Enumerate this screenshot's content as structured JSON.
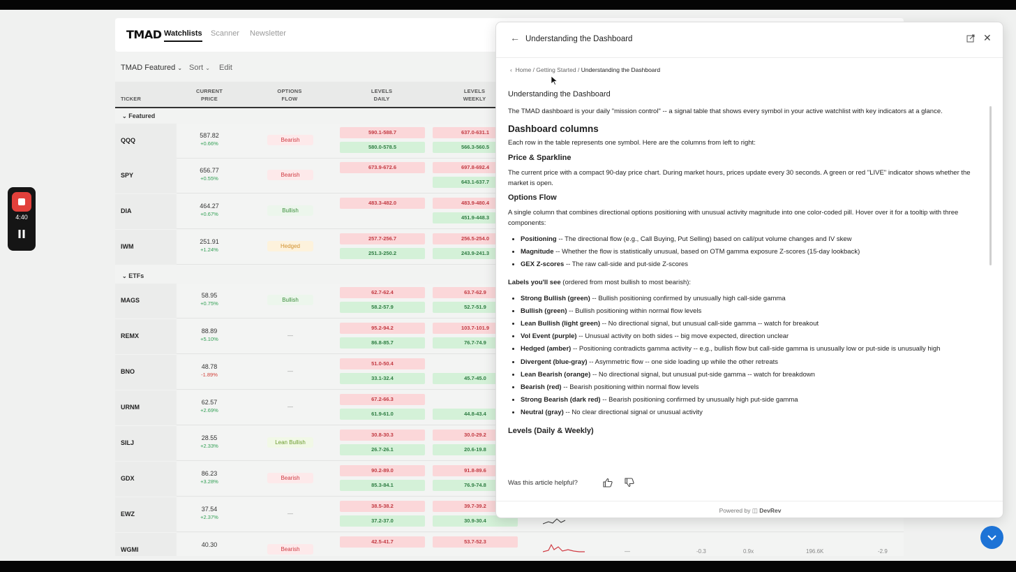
{
  "app": {
    "logo": "TMAD",
    "nav": [
      "Watchlists",
      "Scanner",
      "Newsletter"
    ],
    "toolbar": {
      "watchlist": "TMAD Featured",
      "sort": "Sort",
      "edit": "Edit"
    }
  },
  "table": {
    "headers": {
      "ticker": "TICKER",
      "price_1": "CURRENT",
      "price_2": "PRICE",
      "flow_1": "OPTIONS",
      "flow_2": "FLOW",
      "ld_1": "LEVELS",
      "ld_2": "DAILY",
      "lw_1": "LEVELS",
      "lw_2": "WEEKLY"
    },
    "groups": [
      "Featured",
      "ETFs"
    ],
    "rows": [
      {
        "ticker": "QQQ",
        "price": "587.82",
        "chg": "+0.66%",
        "neg": false,
        "flow": "Bearish",
        "cls": "bear",
        "d1": "590.1-588.7",
        "d2": "580.0-578.5",
        "w1": "637.0-631.1",
        "w2": "566.3-560.5"
      },
      {
        "ticker": "SPY",
        "price": "656.77",
        "chg": "+0.55%",
        "neg": false,
        "flow": "Bearish",
        "cls": "bear",
        "d1": "673.9-672.6",
        "d2": "",
        "w1": "697.8-692.4",
        "w2": "643.1-637.7"
      },
      {
        "ticker": "DIA",
        "price": "464.27",
        "chg": "+0.67%",
        "neg": false,
        "flow": "Bullish",
        "cls": "bull",
        "d1": "483.3-482.0",
        "d2": "",
        "w1": "483.9-480.4",
        "w2": "451.9-448.3"
      },
      {
        "ticker": "IWM",
        "price": "251.91",
        "chg": "+1.24%",
        "neg": false,
        "flow": "Hedged",
        "cls": "hedg",
        "d1": "257.7-256.7",
        "d2": "251.3-250.2",
        "w1": "256.5-254.0",
        "w2": "243.9-241.3"
      },
      {
        "ticker": "MAGS",
        "price": "58.95",
        "chg": "+0.75%",
        "neg": false,
        "flow": "Bullish",
        "cls": "bull",
        "d1": "62.7-62.4",
        "d2": "58.2-57.9",
        "w1": "63.7-62.9",
        "w2": "52.7-51.9"
      },
      {
        "ticker": "REMX",
        "price": "88.89",
        "chg": "+5.10%",
        "neg": false,
        "flow": "—",
        "cls": "none",
        "d1": "95.2-94.2",
        "d2": "86.8-85.7",
        "w1": "103.7-101.9",
        "w2": "76.7-74.9"
      },
      {
        "ticker": "BNO",
        "price": "48.78",
        "chg": "-1.89%",
        "neg": true,
        "flow": "—",
        "cls": "none",
        "d1": "51.0-50.4",
        "d2": "33.1-32.4",
        "w1": "",
        "w2": "45.7-45.0"
      },
      {
        "ticker": "URNM",
        "price": "62.57",
        "chg": "+2.69%",
        "neg": false,
        "flow": "—",
        "cls": "none",
        "d1": "67.2-66.3",
        "d2": "61.9-61.0",
        "w1": "",
        "w2": "44.8-43.4"
      },
      {
        "ticker": "SILJ",
        "price": "28.55",
        "chg": "+2.33%",
        "neg": false,
        "flow": "Lean Bullish",
        "cls": "lean",
        "d1": "30.8-30.3",
        "d2": "26.7-26.1",
        "w1": "30.0-29.2",
        "w2": "20.6-19.8"
      },
      {
        "ticker": "GDX",
        "price": "86.23",
        "chg": "+3.28%",
        "neg": false,
        "flow": "Bearish",
        "cls": "bear",
        "d1": "90.2-89.0",
        "d2": "85.3-84.1",
        "w1": "91.8-89.6",
        "w2": "76.9-74.8"
      },
      {
        "ticker": "EWZ",
        "price": "37.54",
        "chg": "+2.37%",
        "neg": false,
        "flow": "—",
        "cls": "none",
        "d1": "38.5-38.2",
        "d2": "37.2-37.0",
        "w1": "39.7-39.2",
        "w2": "30.9-30.4"
      },
      {
        "ticker": "WGMI",
        "price": "40.30",
        "chg": "",
        "neg": false,
        "flow": "Bearish",
        "cls": "bear",
        "d1": "42.5-41.7",
        "d2": "",
        "w1": "53.7-52.3",
        "w2": ""
      }
    ],
    "peek": [
      "—",
      "-0.3",
      "0.9x",
      "196.6K",
      "-2.9"
    ]
  },
  "panel": {
    "title": "Understanding the Dashboard",
    "breadcrumb": {
      "home": "Home",
      "sep1": "/",
      "getting_started": "Getting Started",
      "sep2": "/",
      "current": "Understanding the Dashboard"
    },
    "h_main": "Understanding the Dashboard",
    "intro": "The TMAD dashboard is your daily \"mission control\" -- a signal table that shows every symbol in your active watchlist with key indicators at a glance.",
    "h_columns": "Dashboard columns",
    "columns_intro": "Each row in the table represents one symbol. Here are the columns from left to right:",
    "h_price": "Price & Sparkline",
    "price_text": "The current price with a compact 90-day price chart. During market hours, prices update every 30 seconds. A green or red \"LIVE\" indicator shows whether the market is open.",
    "h_flow": "Options Flow",
    "flow_text": "A single column that combines directional options positioning with unusual activity magnitude into one color-coded pill. Hover over it for a tooltip with three components:",
    "components": [
      {
        "b": "Positioning",
        "t": " -- The directional flow (e.g., Call Buying, Put Selling) based on call/put volume changes and IV skew"
      },
      {
        "b": "Magnitude",
        "t": " -- Whether the flow is statistically unusual, based on OTM gamma exposure Z-scores (15-day lookback)"
      },
      {
        "b": "GEX Z-scores",
        "t": " -- The raw call-side and put-side Z-scores"
      }
    ],
    "labels_b": "Labels you'll see",
    "labels_t": " (ordered from most bullish to most bearish):",
    "labels": [
      {
        "b": "Strong Bullish (green)",
        "t": " -- Bullish positioning confirmed by unusually high call-side gamma"
      },
      {
        "b": "Bullish (green)",
        "t": " -- Bullish positioning within normal flow levels"
      },
      {
        "b": "Lean Bullish (light green)",
        "t": " -- No directional signal, but unusual call-side gamma -- watch for breakout"
      },
      {
        "b": "Vol Event (purple)",
        "t": " -- Unusual activity on both sides -- big move expected, direction unclear"
      },
      {
        "b": "Hedged (amber)",
        "t": " -- Positioning contradicts gamma activity -- e.g., bullish flow but call-side gamma is unusually low or put-side is unusually high"
      },
      {
        "b": "Divergent (blue-gray)",
        "t": " -- Asymmetric flow -- one side loading up while the other retreats"
      },
      {
        "b": "Lean Bearish (orange)",
        "t": " -- No directional signal, but unusual put-side gamma -- watch for breakdown"
      },
      {
        "b": "Bearish (red)",
        "t": " -- Bearish positioning within normal flow levels"
      },
      {
        "b": "Strong Bearish (dark red)",
        "t": " -- Bearish positioning confirmed by unusually high put-side gamma"
      },
      {
        "b": "Neutral (gray)",
        "t": " -- No clear directional signal or unusual activity"
      }
    ],
    "h_levels": "Levels (Daily & Weekly)",
    "helpful": "Was this article helpful?",
    "powered_by": "Powered by",
    "devrev": "DevRev"
  },
  "recorder": {
    "time": "4:40"
  },
  "colors": {
    "accent": "#1d73d6",
    "record": "#e2403b",
    "bear": "#d03b43",
    "bull": "#3c8f3c"
  }
}
